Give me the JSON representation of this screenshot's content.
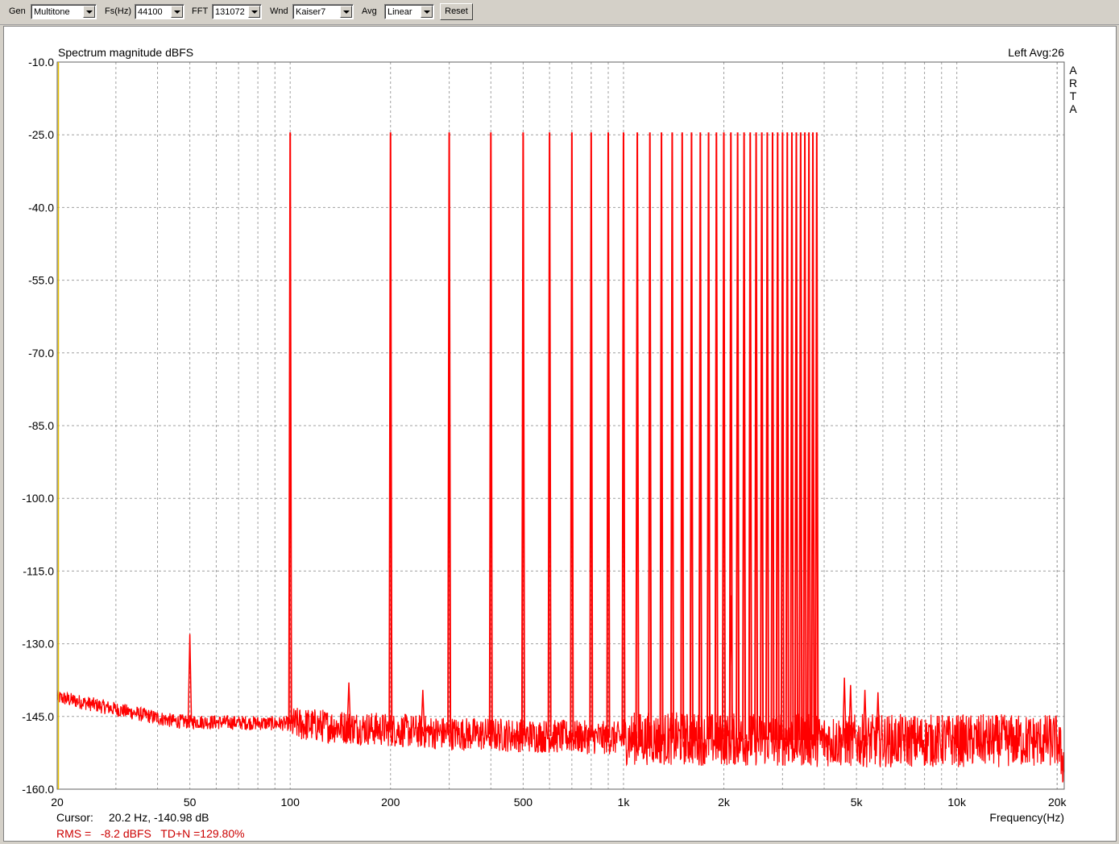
{
  "toolbar": {
    "gen_label": "Gen",
    "gen_value": "Multitone",
    "fs_label": "Fs(Hz)",
    "fs_value": "44100",
    "fft_label": "FFT",
    "fft_value": "131072",
    "wnd_label": "Wnd",
    "wnd_value": "Kaiser7",
    "avg_label": "Avg",
    "avg_value": "Linear",
    "reset_label": "Reset"
  },
  "chart": {
    "title": "Spectrum magnitude dBFS",
    "channel_info": "Left  Avg:26",
    "brand_letters": [
      "A",
      "R",
      "T",
      "A"
    ],
    "xlabel": "Frequency(Hz)",
    "cursor_label": "Cursor:",
    "cursor_value": "20.2 Hz, -140.98 dB",
    "rms_text": "RMS =   -8.2 dBFS   TD+N =129.80%"
  },
  "colors": {
    "trace": "#ff0000",
    "grid": "#a0a0a0",
    "rms_text": "#cc0000",
    "cursor_line": "#e8c000"
  },
  "chart_data": {
    "type": "line",
    "title": "Spectrum magnitude dBFS",
    "xlabel": "Frequency(Hz)",
    "ylabel": "",
    "x_scale": "log",
    "xlim": [
      20,
      21000
    ],
    "ylim": [
      -160,
      -10
    ],
    "x_ticks": [
      {
        "value": 20,
        "label": "20"
      },
      {
        "value": 50,
        "label": "50"
      },
      {
        "value": 100,
        "label": "100"
      },
      {
        "value": 200,
        "label": "200"
      },
      {
        "value": 500,
        "label": "500"
      },
      {
        "value": 1000,
        "label": "1k"
      },
      {
        "value": 2000,
        "label": "2k"
      },
      {
        "value": 5000,
        "label": "5k"
      },
      {
        "value": 10000,
        "label": "10k"
      },
      {
        "value": 20000,
        "label": "20k"
      }
    ],
    "y_ticks": [
      "-10.0",
      "-25.0",
      "-40.0",
      "-55.0",
      "-70.0",
      "-85.0",
      "-100.0",
      "-115.0",
      "-130.0",
      "-145.0",
      "-160.0"
    ],
    "grid": true,
    "tones": {
      "level_db": -24.5,
      "frequencies": [
        100,
        200,
        300,
        400,
        500,
        600,
        700,
        800,
        900,
        1000,
        1100,
        1200,
        1300,
        1400,
        1500,
        1600,
        1700,
        1800,
        1900,
        2000,
        2100,
        2200,
        2300,
        2400,
        2500,
        2600,
        2700,
        2800,
        2900,
        3000,
        3100,
        3200,
        3300,
        3400,
        3500,
        3600,
        3700,
        3800
      ]
    },
    "spurs": [
      {
        "freq": 50,
        "level_db": -128.0
      },
      {
        "freq": 150,
        "level_db": -138.0
      },
      {
        "freq": 250,
        "level_db": -139.5
      },
      {
        "freq": 2100,
        "level_db": -120.0
      },
      {
        "freq": 4600,
        "level_db": -137.0
      },
      {
        "freq": 4800,
        "level_db": -138.5
      },
      {
        "freq": 5300,
        "level_db": -139.5
      },
      {
        "freq": 5800,
        "level_db": -140.0
      }
    ],
    "noise_floor": [
      {
        "freq": 20,
        "level_db": -141.0
      },
      {
        "freq": 30,
        "level_db": -143.5
      },
      {
        "freq": 45,
        "level_db": -146.0
      },
      {
        "freq": 100,
        "level_db": -146.5
      },
      {
        "freq": 300,
        "level_db": -148.5
      },
      {
        "freq": 1000,
        "level_db": -149.5
      },
      {
        "freq": 5000,
        "level_db": -150.0
      },
      {
        "freq": 20000,
        "level_db": -150.0
      },
      {
        "freq": 21000,
        "level_db": -155.0
      }
    ]
  }
}
